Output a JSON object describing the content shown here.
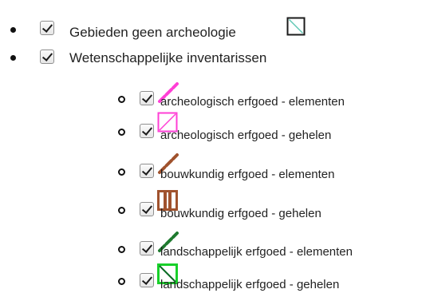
{
  "layers": [
    {
      "label": "Gebieden geen archeologie",
      "checked": true,
      "symbol": {
        "kind": "polygon",
        "fill": "#ffffff",
        "stroke": "#1b1b1b",
        "diag": "#5fc7b4"
      },
      "icon": "polygon-outline-icon"
    },
    {
      "label": "Wetenschappelijke inventarissen",
      "checked": true,
      "children": [
        {
          "label": "archeologisch erfgoed - elementen",
          "checked": true,
          "symbol": {
            "kind": "line",
            "color": "#ff3fd5"
          },
          "icon": "pink-line-icon"
        },
        {
          "label": "archeologisch erfgoed - gehelen",
          "checked": true,
          "symbol": {
            "kind": "polygon",
            "fill": "#ffffff",
            "stroke": "#ff3fd5",
            "diag": "#ff3fd5"
          },
          "icon": "pink-polygon-icon"
        },
        {
          "label": "bouwkundig erfgoed - elementen",
          "checked": true,
          "symbol": {
            "kind": "line",
            "color": "#a0522d"
          },
          "icon": "brown-line-icon"
        },
        {
          "label": "bouwkundig erfgoed - gehelen",
          "checked": true,
          "symbol": {
            "kind": "polygon-bars",
            "fill": "#ffffff",
            "stroke": "#a0522d"
          },
          "icon": "brown-polygon-icon"
        },
        {
          "label": "landschappelijk erfgoed - elementen",
          "checked": true,
          "symbol": {
            "kind": "line",
            "color": "#1f7a2f"
          },
          "icon": "green-line-icon"
        },
        {
          "label": "landschappelijk erfgoed - gehelen",
          "checked": true,
          "symbol": {
            "kind": "polygon",
            "fill": "#ffffff",
            "stroke": "#18d02a",
            "diag": "#0b6b24"
          },
          "icon": "green-polygon-icon"
        }
      ]
    }
  ]
}
